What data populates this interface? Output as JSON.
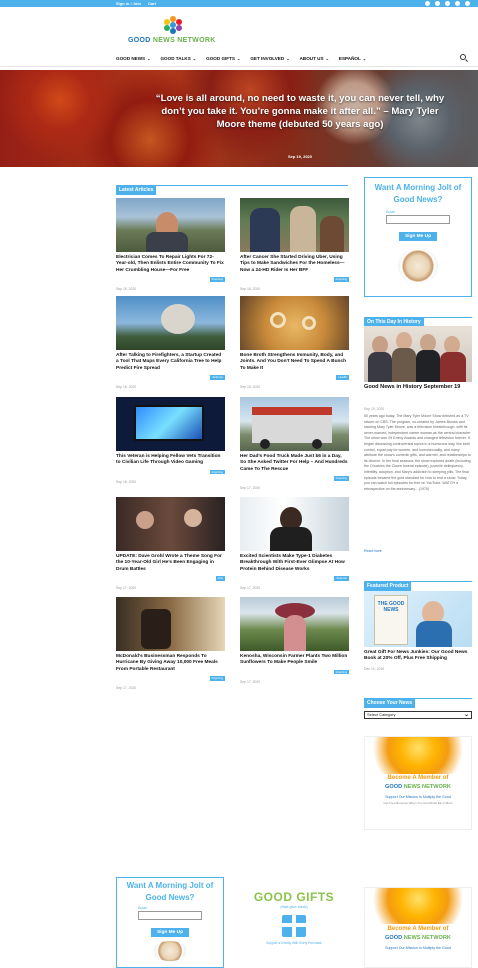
{
  "topbar": {
    "links": [
      "Sign in / Join",
      "Cart"
    ]
  },
  "logo": {
    "text_good": "GOOD",
    "text_rest": " NEWS NETWORK"
  },
  "nav": {
    "items": [
      "GOOD NEWS",
      "GOOD TALKS",
      "GOOD GIFTS",
      "GET INVOLVED",
      "ABOUT US",
      "ESPAÑOL"
    ]
  },
  "hero": {
    "quote": "“Love is all around, no need to waste it, you can never tell, why don’t you take it. You’re gonna make it after all.” – Mary Tyler Moore theme (debuted 50 years ago)",
    "date": "Sep 19, 2020"
  },
  "latest": {
    "heading": "Latest Articles",
    "articles": [
      {
        "title": "Electrician Comes To Repair Lights For 72-Year-old, Then Enlists Entire Community To Fix Her Crumbling House—For Free",
        "date": "Sep 18, 2020",
        "tag": "Inspiring"
      },
      {
        "title": "After Cancer She Started Driving Uber, Using Tips to Make Sandwiches For the Homeless—Now a 24-HD Rider Is Her BFF",
        "date": "Sep 18, 2020",
        "tag": "Inspiring"
      },
      {
        "title": "After Talking to Firefighters, a Startup Created a Tool That Maps Every California Tree to Help Predict Fire Spread",
        "date": "Sep 18, 2020",
        "tag": "Science"
      },
      {
        "title": "Bone Broth Strengthens Immunity, Body, and Joints. And You Don’t Need To Spend A Bunch To Make It",
        "date": "Sep 18, 2020",
        "tag": "Health"
      },
      {
        "title": "This Veteran is Helping Fellow Vets Transition to Civilian Life Through Video Gaming",
        "date": "Sep 18, 2020",
        "tag": "Inspiring"
      },
      {
        "title": "Her Dad’s Food Truck Made Just $6 in a Day, So She Asked Twitter For Help – And Hundreds Came To The Rescue",
        "date": "Sep 17, 2020",
        "tag": "Inspiring"
      },
      {
        "title": "UPDATE: Dave Grohl Wrote a Theme Song For the 10-Year-Old Girl He’s Been Engaging in Drum Battles",
        "date": "Sep 17, 2020",
        "tag": "Arts"
      },
      {
        "title": "Excited Scientists Make Type-1 Diabetes Breakthrough With First-Ever Glimpse At How Protein Behind Disease Works",
        "date": "Sep 17, 2020",
        "tag": "Science"
      },
      {
        "title": "McDonald’s Businessman Responds To Hurricane By Giving Away 10,000 Free Meals From Portable Restaurant",
        "date": "Sep 17, 2020",
        "tag": "Inspiring"
      },
      {
        "title": "Kenosha, Wisconsin Farmer Plants Two Million Sunflowers To Make People Smile",
        "date": "Sep 17, 2020",
        "tag": "Inspiring"
      }
    ]
  },
  "jolt": {
    "heading": "Want A Morning Jolt of Good News?",
    "email_label": "Email",
    "button": "Sign Me Up"
  },
  "history": {
    "heading": "On This Day In History",
    "title": "Good News in History September 19",
    "date": "Sep 19, 2020",
    "body": "50 years ago today, The Mary Tyler Moore Show debuted as a TV sitcom on CBS. The program, co-created by James Brooks and starring Mary Tyler Moore, was a television breakthrough, with its never-married, independent career woman as the central character. The show won 29 Emmy Awards and changed television forever. It began discussing controversial topics in a humorous way, like birth control, equal pay for women, and homosexuality, and many attribute the show's comedic gifts, and warmth, and relationships to its divorce. In the final seasons, the show explored death (including the Chuckles the Clown funeral episode), juvenile delinquency, infertility, adoption, and Mary's addiction to sleeping pills. The final episode became the gold standard for how to end a show. Today, you can watch full episodes for free on YouTube. WATCH a retrospective on the anniversary... (1970)",
    "read_more": "Read more"
  },
  "featured": {
    "heading": "Featured Product",
    "book_top": "THE GOOD NEWS",
    "title": "Great Gift For News Junkies: Our Good News Book at 20% Off, Plus Free Shipping",
    "date": "Dec 19, 2019"
  },
  "choose": {
    "heading": "Choose Your News",
    "select_value": "Select Category"
  },
  "promo": {
    "line1": "Become A Member of",
    "line2_good": "GOOD",
    "line2_rest": " NEWS NETWORK",
    "line3": "Support Our Mission to Multiply the Good",
    "line4": "Get Free Bonuses When You Contribute $3 or More"
  },
  "gifts": {
    "title": "GOOD GIFTS",
    "sub": "(that give back)",
    "caption": "Support a Charity With Every Purchase"
  },
  "colors": {
    "accent": "#4db2ec",
    "brand_green": "#6ab04c",
    "brand_blue": "#1e73be"
  }
}
